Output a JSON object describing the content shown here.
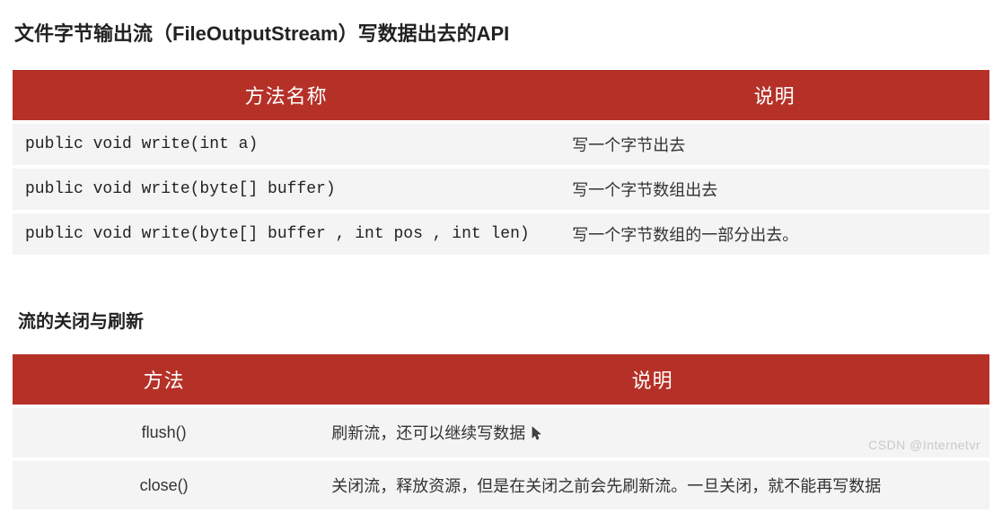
{
  "title1": "文件字节输出流（FileOutputStream）写数据出去的API",
  "table1": {
    "headers": [
      "方法名称",
      "说明"
    ],
    "rows": [
      {
        "method": "public void write(int a)",
        "desc": "写一个字节出去"
      },
      {
        "method": "public void write(byte[] buffer)",
        "desc": "写一个字节数组出去"
      },
      {
        "method": "public void write(byte[] buffer , int pos , int len)",
        "desc": "写一个字节数组的一部分出去。"
      }
    ]
  },
  "title2": "流的关闭与刷新",
  "table2": {
    "headers": [
      "方法",
      "说明"
    ],
    "rows": [
      {
        "method": "flush()",
        "desc": "刷新流，还可以继续写数据"
      },
      {
        "method": "close()",
        "desc": "关闭流，释放资源，但是在关闭之前会先刷新流。一旦关闭，就不能再写数据"
      }
    ]
  },
  "watermark": "CSDN @Internetvr"
}
